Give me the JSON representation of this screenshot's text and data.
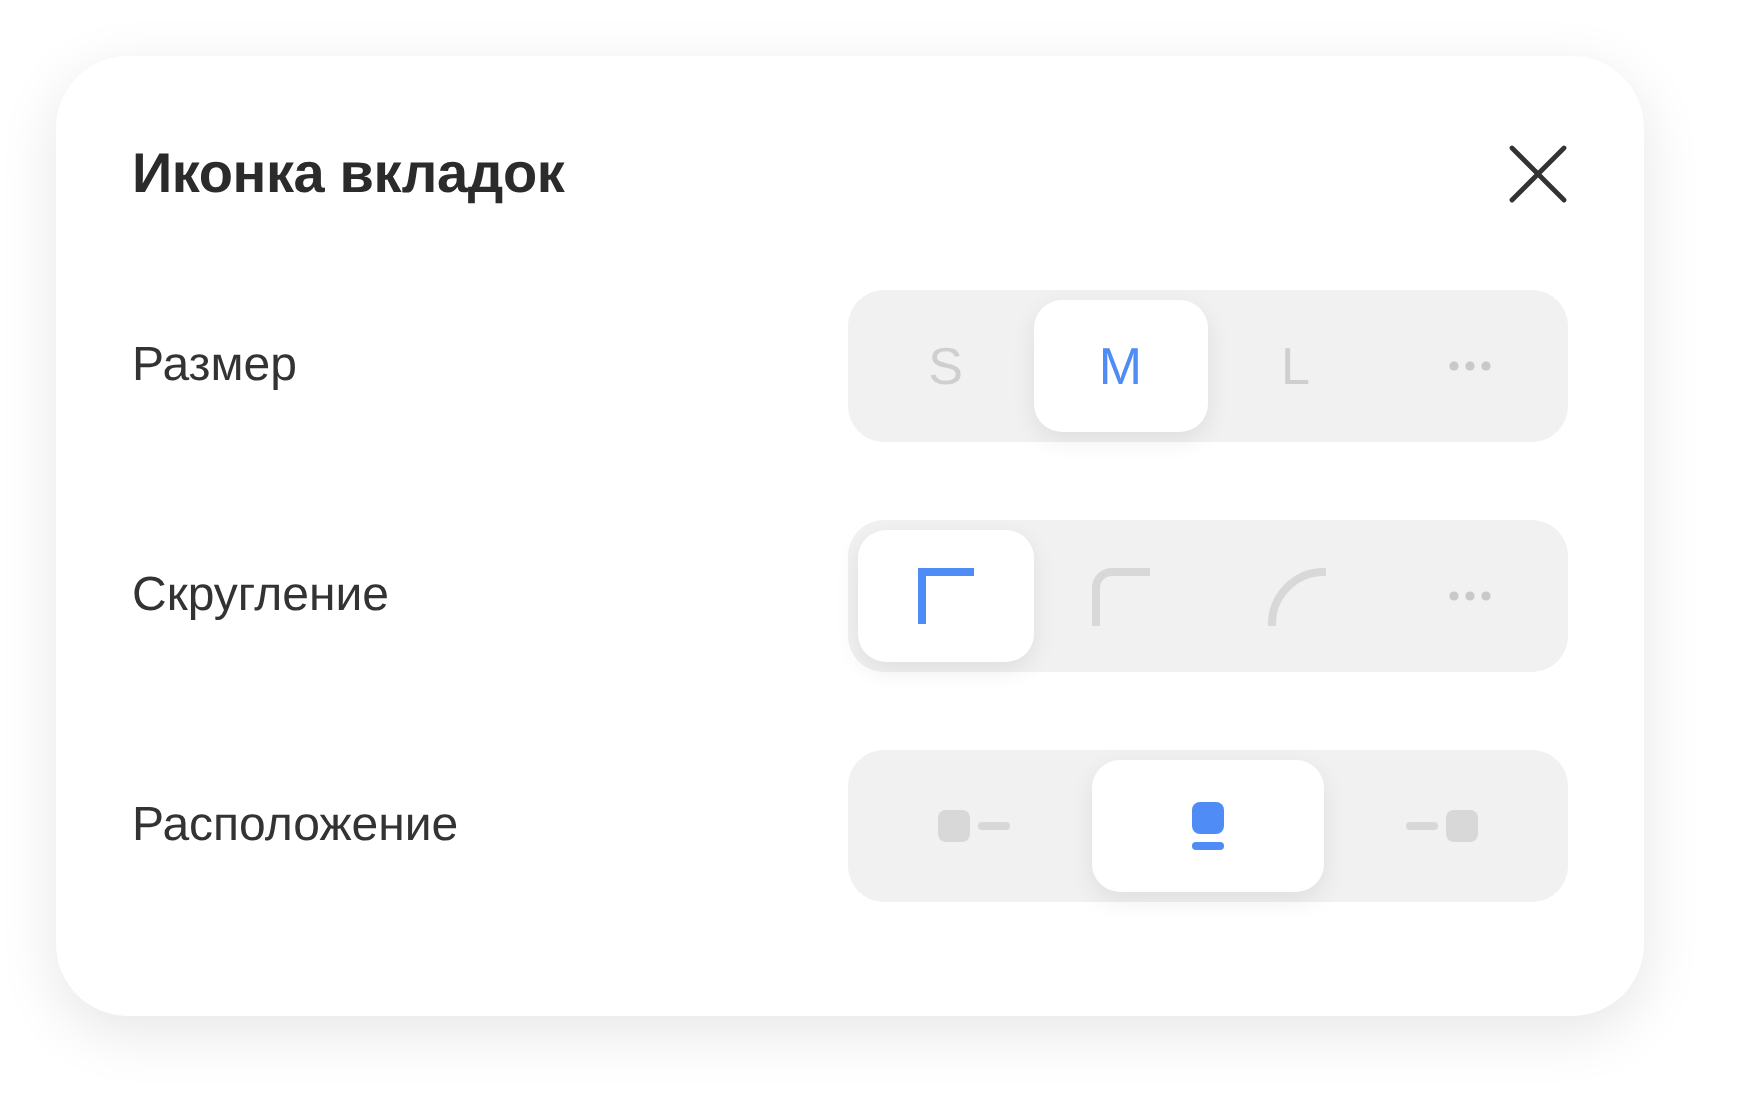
{
  "dialog": {
    "title": "Иконка вкладок"
  },
  "settings": [
    {
      "label": "Размер",
      "options": [
        {
          "kind": "text",
          "label": "S",
          "selected": false
        },
        {
          "kind": "text",
          "label": "M",
          "selected": true
        },
        {
          "kind": "text",
          "label": "L",
          "selected": false
        },
        {
          "kind": "more",
          "selected": false
        }
      ]
    },
    {
      "label": "Скругление",
      "options": [
        {
          "kind": "corner-square",
          "selected": true
        },
        {
          "kind": "corner-round",
          "selected": false
        },
        {
          "kind": "corner-arc",
          "selected": false
        },
        {
          "kind": "more",
          "selected": false
        }
      ]
    },
    {
      "label": "Расположение",
      "options": [
        {
          "kind": "position-left",
          "selected": false
        },
        {
          "kind": "position-bottom",
          "selected": true
        },
        {
          "kind": "position-right",
          "selected": false
        }
      ]
    }
  ]
}
